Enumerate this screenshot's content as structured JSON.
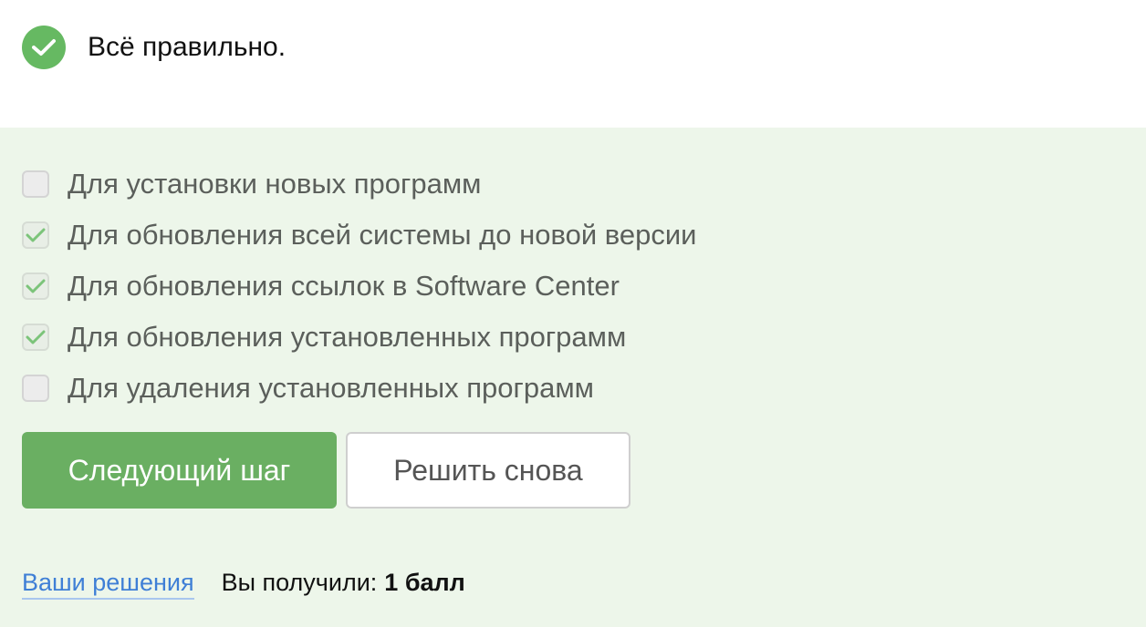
{
  "feedback": {
    "status_text": "Всё правильно.",
    "status_color": "#66b962",
    "icon": "check-circle-icon"
  },
  "options": [
    {
      "label": "Для установки новых программ",
      "checked": false
    },
    {
      "label": "Для обновления всей системы до новой версии",
      "checked": true
    },
    {
      "label": "Для обновления ссылок в Software Center",
      "checked": true
    },
    {
      "label": "Для обновления установленных программ",
      "checked": true
    },
    {
      "label": "Для удаления установленных программ",
      "checked": false
    }
  ],
  "buttons": {
    "next_label": "Следующий шаг",
    "retry_label": "Решить снова"
  },
  "footer": {
    "solutions_link": "Ваши решения",
    "score_prefix": "Вы получили:",
    "score_value": "1 балл"
  },
  "colors": {
    "quiz_background": "#edf6ea",
    "primary_button": "#6aaf62",
    "link": "#3f7fd6"
  }
}
